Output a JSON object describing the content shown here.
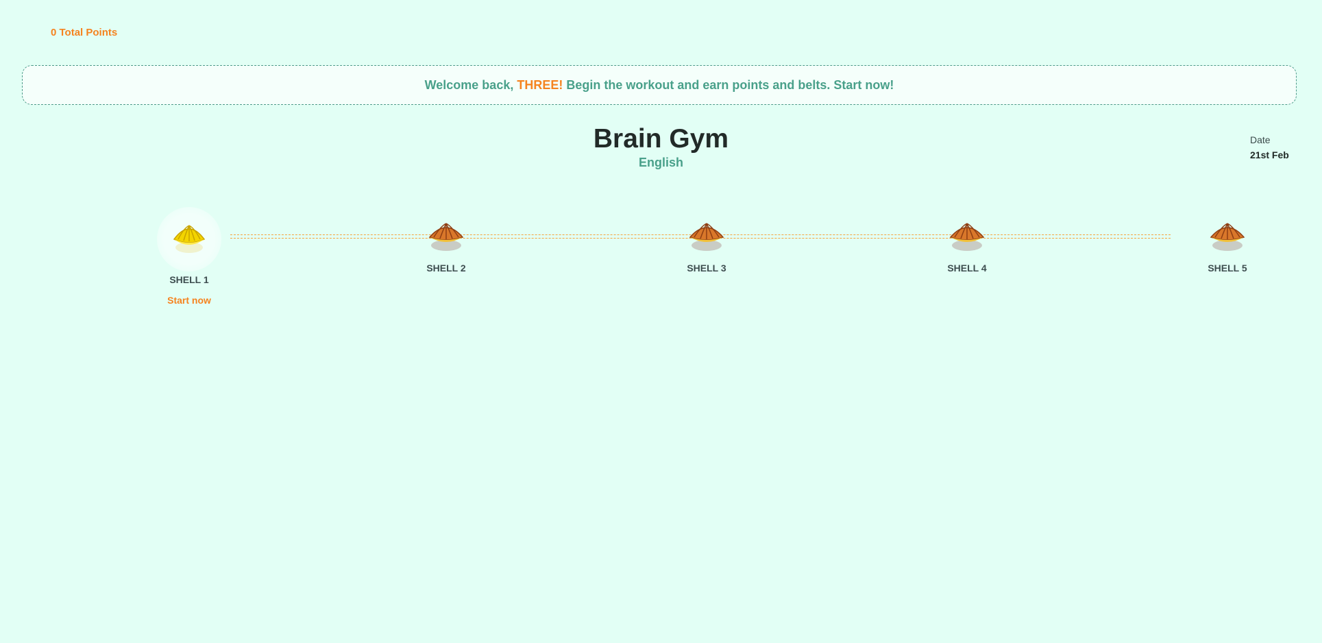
{
  "header": {
    "points_label": "0 Total Points"
  },
  "banner": {
    "prefix": "Welcome back,",
    "name": "THREE!",
    "suffix": "Begin the workout and earn points and belts. Start now!"
  },
  "page": {
    "title": "Brain Gym",
    "subtitle": "English"
  },
  "date": {
    "label": "Date",
    "value": "21st Feb"
  },
  "stages": [
    {
      "label": "SHELL 1",
      "action": "Start now",
      "state": "active",
      "icon": "yellow-shell-icon"
    },
    {
      "label": "SHELL 2",
      "state": "locked",
      "icon": "orange-shell-icon"
    },
    {
      "label": "SHELL 3",
      "state": "locked",
      "icon": "orange-shell-icon"
    },
    {
      "label": "SHELL 4",
      "state": "locked",
      "icon": "orange-shell-icon"
    },
    {
      "label": "SHELL 5",
      "state": "locked",
      "icon": "orange-shell-icon"
    }
  ],
  "colors": {
    "background": "#e2fff5",
    "accent_orange": "#f5831f",
    "accent_green": "#49a08a",
    "active_shell": "#f3d400",
    "locked_shell": "#d9772a"
  }
}
